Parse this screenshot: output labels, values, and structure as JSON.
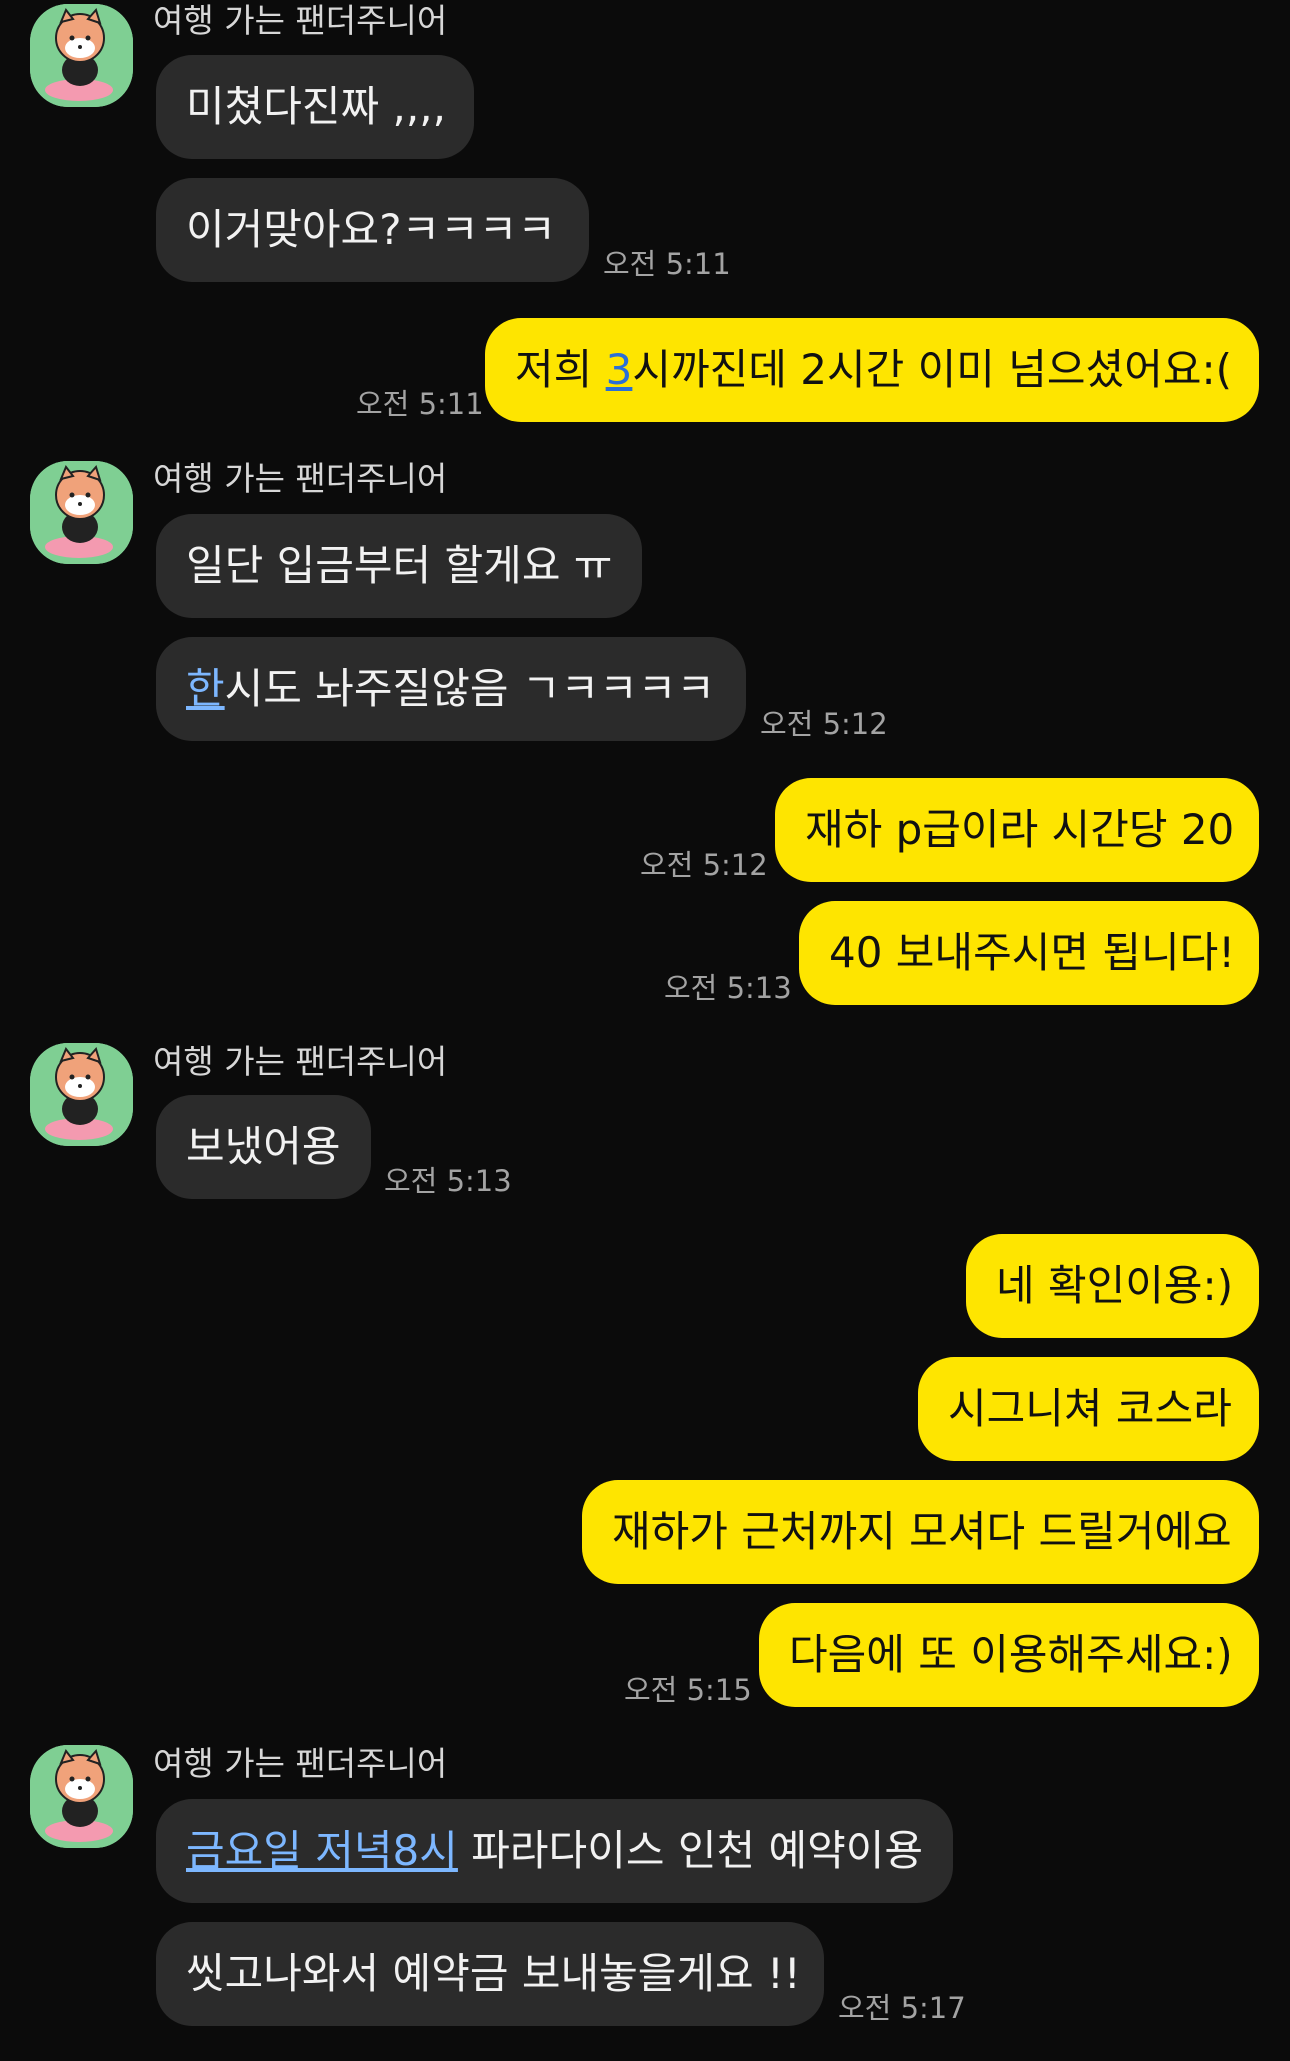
{
  "sender_name": "여행 가는 팬더주니어",
  "groups": [
    {
      "messages": [
        {
          "text": "미쳤다진짜 ,,,,"
        },
        {
          "text": "이거맞아요?ㅋㅋㅋㅋ",
          "time": "오전 5:11"
        }
      ]
    },
    {
      "messages": [
        {
          "prefix": "저희 ",
          "link": "3",
          "text": "시까진데 2시간 이미 넘으셨어요:(",
          "time": "오전 5:11"
        }
      ]
    },
    {
      "messages": [
        {
          "text": "일단 입금부터 할게요 ㅠ"
        },
        {
          "link": "한",
          "text": "시도 놔주질않음 ㄱㅋㅋㅋㅋ",
          "time": "오전 5:12"
        }
      ]
    },
    {
      "messages": [
        {
          "text": "재하 p급이라 시간당 20",
          "time": "오전 5:12"
        },
        {
          "text": "40 보내주시면 됩니다!",
          "time": "오전 5:13"
        }
      ]
    },
    {
      "messages": [
        {
          "text": "보냈어용",
          "time": "오전 5:13"
        }
      ]
    },
    {
      "messages": [
        {
          "text": "네 확인이용:)"
        },
        {
          "text": "시그니쳐 코스라"
        },
        {
          "text": "재하가 근처까지 모셔다 드릴거에요"
        },
        {
          "text": "다음에 또 이용해주세요:)",
          "time": "오전 5:15"
        }
      ]
    },
    {
      "messages": [
        {
          "link": "금요일 저녁8시",
          "text": " 파라다이스 인천 예약이용"
        },
        {
          "text": "씻고나와서 예약금 보내놓을게요 !!",
          "time": "오전 5:17"
        }
      ]
    }
  ]
}
